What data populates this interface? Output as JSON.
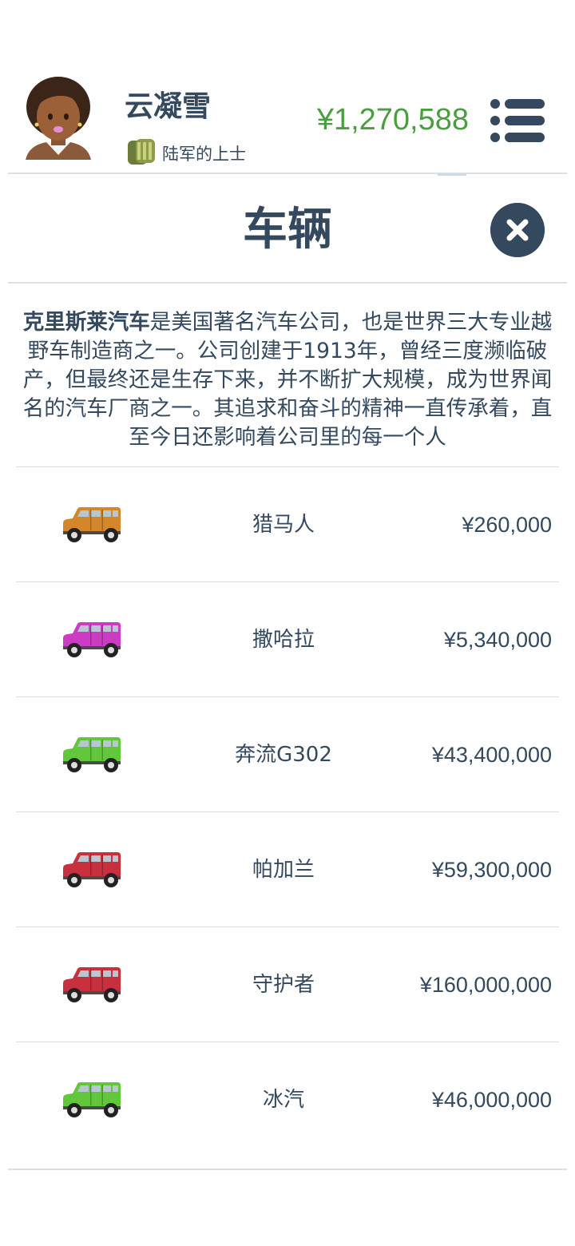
{
  "user": {
    "name": "云凝雪",
    "rank": "陆军的上士",
    "money": "¥1,270,588"
  },
  "page": {
    "title": "车辆"
  },
  "brand": {
    "name": "克里斯莱汽车",
    "description": "是美国著名汽车公司，也是世界三大专业越野车制造商之一。公司创建于1913年，曾经三度濒临破产，但最终还是生存下来，并不断扩大规模，成为世界闻名的汽车厂商之一。其追求和奋斗的精神一直传承着，直至今日还影响着公司里的每一个人"
  },
  "colors": {
    "money": "#4a9e3f",
    "text": "#34495e"
  },
  "vehicles": [
    {
      "name": "猎马人",
      "price": "¥260,000",
      "color": "#d4862a",
      "icon": "suv-icon"
    },
    {
      "name": "撒哈拉",
      "price": "¥5,340,000",
      "color": "#cc3cc2",
      "icon": "suv-icon"
    },
    {
      "name": "奔流G302",
      "price": "¥43,400,000",
      "color": "#62c73a",
      "icon": "suv-icon"
    },
    {
      "name": "帕加兰",
      "price": "¥59,300,000",
      "color": "#c8303e",
      "icon": "suv-icon"
    },
    {
      "name": "守护者",
      "price": "¥160,000,000",
      "color": "#c8303e",
      "icon": "suv-icon"
    },
    {
      "name": "冰汽",
      "price": "¥46,000,000",
      "color": "#62c73a",
      "icon": "suv-icon"
    }
  ]
}
